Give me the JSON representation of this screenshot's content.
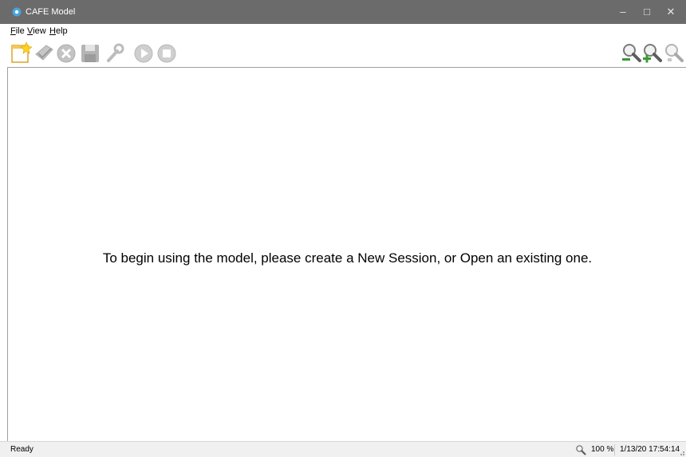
{
  "window": {
    "title": "CAFE Model",
    "controls": {
      "minimize": "–",
      "maximize": "□",
      "close": "✕"
    },
    "titlebar_color": "#6b6b6b"
  },
  "menu": [
    {
      "underline": "F",
      "rest": "ile"
    },
    {
      "underline": "V",
      "rest": "iew"
    },
    {
      "underline": "H",
      "rest": "elp"
    }
  ],
  "toolbar": {
    "left_icons": [
      "new-session-icon",
      "open-session-icon",
      "close-session-icon",
      "save-icon",
      "settings-wrench-icon",
      "run-play-icon",
      "stop-icon"
    ],
    "right_icons": [
      "zoom-out-icon",
      "zoom-in-icon",
      "zoom-reset-icon"
    ]
  },
  "main": {
    "message": "To begin using the model, please create a New Session, or Open an existing one."
  },
  "status": {
    "text": "Ready",
    "zoom": "100 %",
    "datetime": "1/13/20 17:54:14"
  }
}
